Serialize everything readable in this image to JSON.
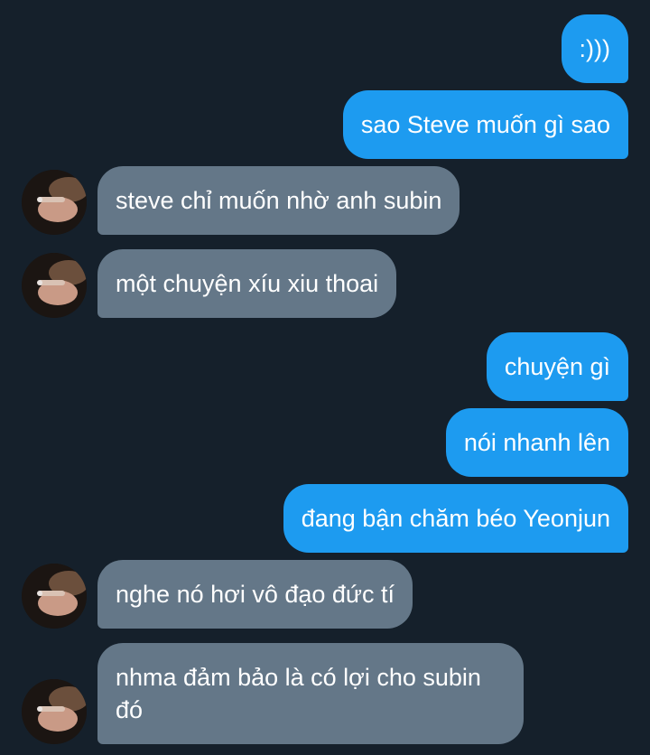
{
  "conversation": {
    "messages": [
      {
        "side": "outgoing",
        "text": ":)))"
      },
      {
        "side": "outgoing",
        "text": "sao Steve muốn gì sao"
      },
      {
        "side": "incoming",
        "text": "steve chỉ muốn nhờ anh subin"
      },
      {
        "side": "incoming",
        "text": "một chuyện xíu xiu thoai"
      },
      {
        "side": "outgoing",
        "text": "chuyện gì"
      },
      {
        "side": "outgoing",
        "text": "nói nhanh lên"
      },
      {
        "side": "outgoing",
        "text": "đang bận chăm béo Yeonjun"
      },
      {
        "side": "incoming",
        "text": "nghe nó hơi vô đạo đức tí"
      },
      {
        "side": "incoming",
        "text": "nhma đảm bảo là có lợi cho subin đó"
      }
    ]
  },
  "colors": {
    "background": "#15202b",
    "outgoing_bubble": "#1d9bf0",
    "incoming_bubble": "#647788",
    "text": "#ffffff"
  }
}
